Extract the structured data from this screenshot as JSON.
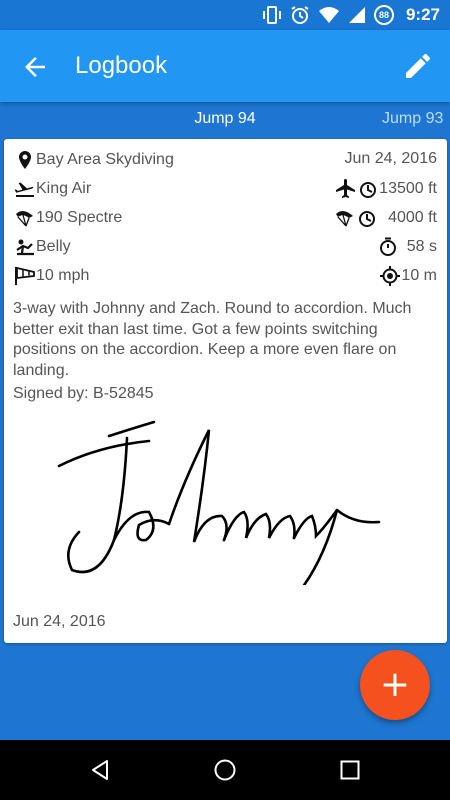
{
  "status_bar": {
    "time": "9:27",
    "battery": "88"
  },
  "app_bar": {
    "title": "Logbook",
    "back_icon": "arrow-back-icon",
    "edit_icon": "pencil-icon"
  },
  "tabs": {
    "current": "Jump 94",
    "next": "Jump 93"
  },
  "jump": {
    "location": "Bay Area Skydiving",
    "date": "Jun 24, 2016",
    "aircraft": "King Air",
    "exit_altitude": "13500 ft",
    "canopy": "190 Spectre",
    "deploy_altitude": "4000 ft",
    "discipline": "Belly",
    "freefall_time": "58 s",
    "wind": "10 mph",
    "landing_distance": "10 m",
    "notes": "3-way with Johnny and Zach. Round to accordion. Much better exit than last time. Got a few points switching positions on the accordion. Keep a more even flare on landing.",
    "signed_by": "Signed by: B-52845",
    "signature_name": "Johnny",
    "signature_date": "Jun 24, 2016"
  },
  "fab": {
    "label": "+"
  },
  "colors": {
    "primary": "#2196f3",
    "status_bar": "#1976d2",
    "accent": "#f4511e",
    "background": "#1e76d2"
  }
}
